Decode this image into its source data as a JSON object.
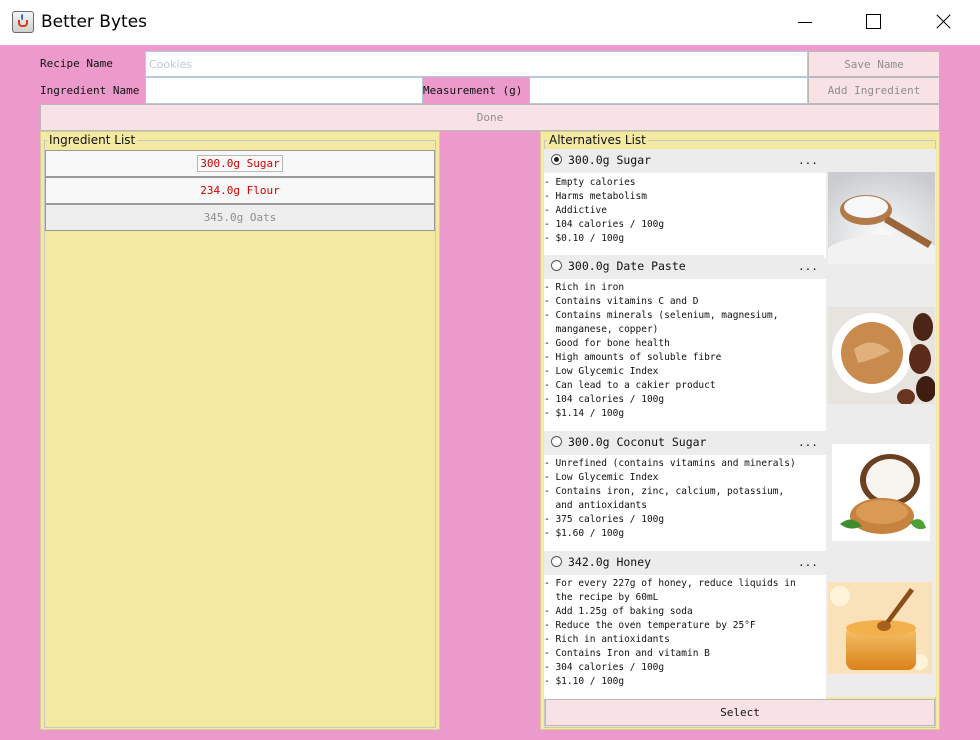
{
  "window": {
    "title": "Better Bytes"
  },
  "form": {
    "recipe_label": "Recipe Name",
    "recipe_placeholder": "Cookies",
    "recipe_value": "",
    "save_name_label": "Save Name",
    "ingredient_label": "Ingredient Name",
    "ingredient_value": "",
    "measurement_label": "Measurement (g)",
    "measurement_value": "",
    "add_ingredient_label": "Add Ingredient",
    "done_label": "Done"
  },
  "ingredients": {
    "title": "Ingredient List",
    "items": [
      "300.0g Sugar",
      "234.0g Flour",
      "345.0g Oats"
    ]
  },
  "alternatives": {
    "title": "Alternatives List",
    "more_label": "...",
    "select_label": "Select",
    "items": [
      {
        "title": "300.0g Sugar",
        "selected": true,
        "image": "sugar-spoon-image",
        "lines": [
          "- Empty calories",
          "- Harms metabolism",
          "- Addictive",
          "- 104 calories / 100g",
          "- $0.10 / 100g"
        ]
      },
      {
        "title": "300.0g Date Paste",
        "selected": false,
        "image": "date-paste-image",
        "lines": [
          "- Rich in iron",
          "- Contains vitamins C and D",
          "- Contains minerals (selenium, magnesium,",
          "  manganese, copper)",
          "- Good for bone health",
          "- High amounts of soluble fibre",
          "- Low Glycemic Index",
          "- Can lead to a cakier product",
          "- 104 calories / 100g",
          "- $1.14 / 100g"
        ]
      },
      {
        "title": "300.0g Coconut Sugar",
        "selected": false,
        "image": "coconut-sugar-image",
        "lines": [
          "- Unrefined (contains vitamins and minerals)",
          "- Low Glycemic Index",
          "- Contains iron, zinc, calcium, potassium,",
          "  and antioxidants",
          "- 375 calories / 100g",
          "- $1.60 / 100g"
        ]
      },
      {
        "title": "342.0g Honey",
        "selected": false,
        "image": "honey-image",
        "lines": [
          "- For every 227g of honey, reduce liquids in",
          "  the recipe by 60mL",
          "- Add 1.25g of baking soda",
          "- Reduce the oven temperature by 25°F",
          "- Rich in antioxidants",
          "- Contains Iron and vitamin B",
          "- 304 calories / 100g",
          "- $1.10 / 100g"
        ]
      }
    ]
  },
  "colors": {
    "background": "#ec9acb",
    "panel": "#f3e9a0",
    "button": "#f8e2e6",
    "ingredient_text": "#d40000"
  }
}
